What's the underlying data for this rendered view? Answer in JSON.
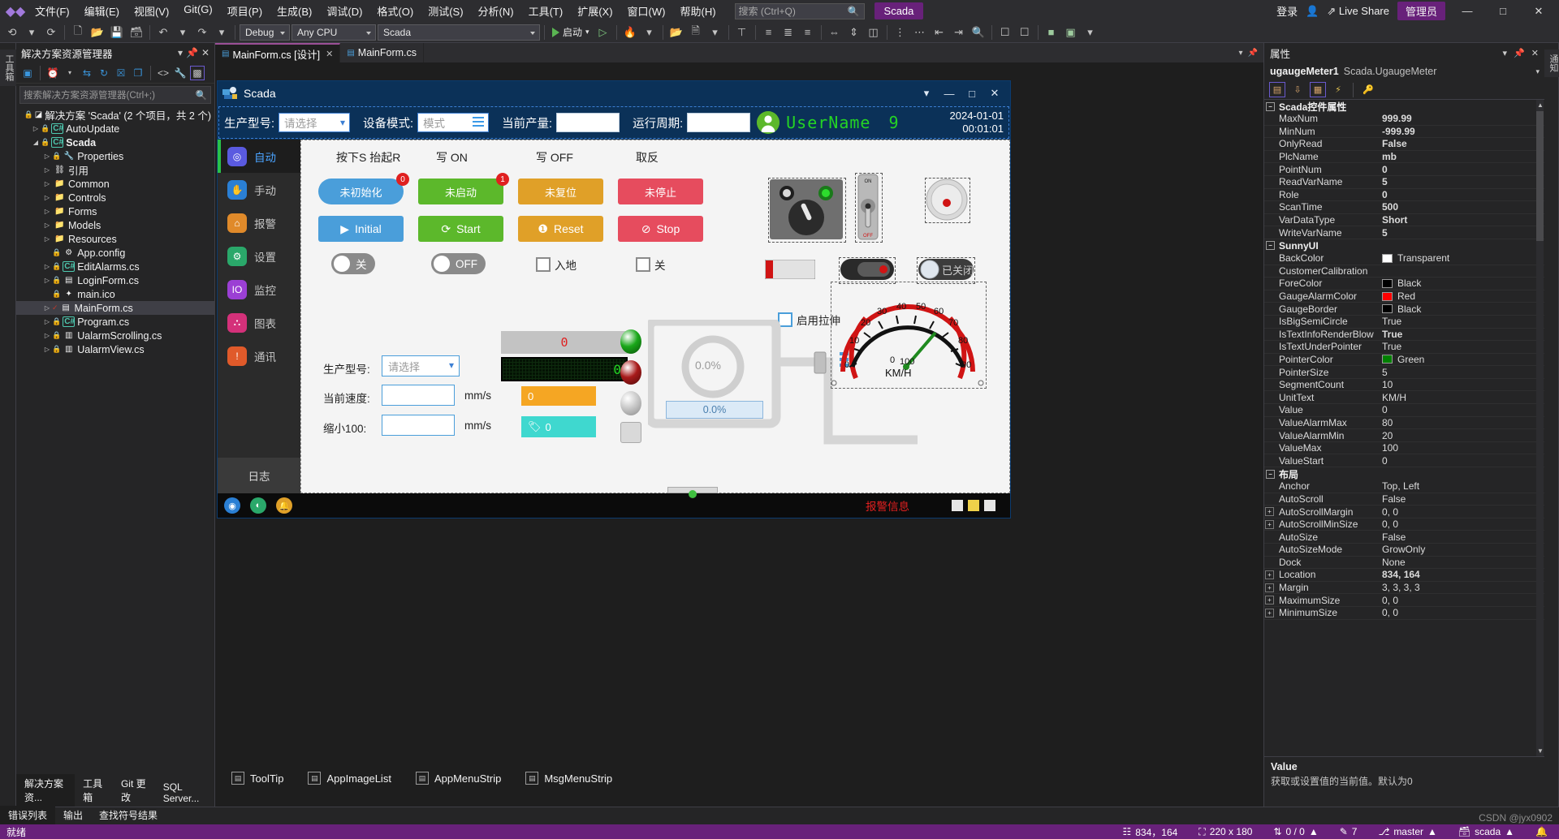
{
  "ide": {
    "menus": [
      "文件(F)",
      "编辑(E)",
      "视图(V)",
      "Git(G)",
      "项目(P)",
      "生成(B)",
      "调试(D)",
      "格式(O)",
      "测试(S)",
      "分析(N)",
      "工具(T)",
      "扩展(X)",
      "窗口(W)",
      "帮助(H)"
    ],
    "search_placeholder": "搜索 (Ctrl+Q)",
    "project_chip": "Scada",
    "login_label": "登录",
    "live_share": "Live Share",
    "admin_badge": "管理员",
    "toolbar": {
      "config": "Debug",
      "platform": "Any CPU",
      "startup_project": "Scada",
      "run_label": "启动"
    }
  },
  "solution_explorer": {
    "title": "解决方案资源管理器",
    "search_placeholder": "搜索解决方案资源管理器(Ctrl+;)",
    "rail_tab": "工具箱",
    "tree": [
      {
        "label": "解决方案 'Scada' (2 个项目，共 2 个)",
        "indent": 0,
        "arrow": "",
        "icon": "solution-icon",
        "lock": true,
        "bold": false
      },
      {
        "label": "AutoUpdate",
        "indent": 1,
        "arrow": "▷",
        "icon": "csharp-icon",
        "lock": true,
        "bold": false
      },
      {
        "label": "Scada",
        "indent": 1,
        "arrow": "◢",
        "icon": "csharp-icon",
        "lock": true,
        "bold": true
      },
      {
        "label": "Properties",
        "indent": 2,
        "arrow": "▷",
        "icon": "wrench-icon",
        "lock": true,
        "bold": false
      },
      {
        "label": "引用",
        "indent": 2,
        "arrow": "▷",
        "icon": "references-icon",
        "lock": false,
        "bold": false
      },
      {
        "label": "Common",
        "indent": 2,
        "arrow": "▷",
        "icon": "folder-icon",
        "lock": false,
        "bold": false
      },
      {
        "label": "Controls",
        "indent": 2,
        "arrow": "▷",
        "icon": "folder-icon",
        "lock": false,
        "bold": false
      },
      {
        "label": "Forms",
        "indent": 2,
        "arrow": "▷",
        "icon": "folder-icon",
        "lock": false,
        "bold": false
      },
      {
        "label": "Models",
        "indent": 2,
        "arrow": "▷",
        "icon": "folder-icon",
        "lock": false,
        "bold": false
      },
      {
        "label": "Resources",
        "indent": 2,
        "arrow": "▷",
        "icon": "folder-icon",
        "lock": false,
        "bold": false
      },
      {
        "label": "App.config",
        "indent": 2,
        "arrow": "",
        "icon": "config-icon",
        "lock": true,
        "bold": false
      },
      {
        "label": "EditAlarms.cs",
        "indent": 2,
        "arrow": "▷",
        "icon": "csharp-icon",
        "lock": true,
        "bold": false
      },
      {
        "label": "LoginForm.cs",
        "indent": 2,
        "arrow": "▷",
        "icon": "form-icon",
        "lock": true,
        "bold": false
      },
      {
        "label": "main.ico",
        "indent": 2,
        "arrow": "",
        "icon": "image-icon",
        "lock": true,
        "bold": false
      },
      {
        "label": "MainForm.cs",
        "indent": 2,
        "arrow": "▷",
        "icon": "form-icon",
        "lock": false,
        "bold": false,
        "selected": true,
        "check": true
      },
      {
        "label": "Program.cs",
        "indent": 2,
        "arrow": "▷",
        "icon": "csharp-icon",
        "lock": true,
        "bold": false
      },
      {
        "label": "UalarmScrolling.cs",
        "indent": 2,
        "arrow": "▷",
        "icon": "usercontrol-icon",
        "lock": true,
        "bold": false
      },
      {
        "label": "UalarmView.cs",
        "indent": 2,
        "arrow": "▷",
        "icon": "usercontrol-icon",
        "lock": true,
        "bold": false
      }
    ],
    "bottom_tabs": [
      "解决方案资...",
      "工具箱",
      "Git 更改",
      "SQL Server..."
    ]
  },
  "editor_tabs": [
    {
      "label": "MainForm.cs [设计]",
      "active": true,
      "closable": true
    },
    {
      "label": "MainForm.cs",
      "active": false,
      "closable": false
    }
  ],
  "scada": {
    "title": "Scada",
    "header": {
      "model_label": "生产型号:",
      "model_value": "请选择",
      "mode_label": "设备模式:",
      "mode_value": "模式",
      "output_label": "当前产量:",
      "output_value": "",
      "cycle_label": "运行周期:",
      "cycle_value": "",
      "user_name": "UserName",
      "user_num": "9",
      "date": "2024-01-01",
      "time": "00:01:01"
    },
    "nav": [
      {
        "label": "自动",
        "icon": "auto-icon",
        "color": "#5a5ae0",
        "active": true
      },
      {
        "label": "手动",
        "icon": "hand-icon",
        "color": "#2a7fd4",
        "active": false
      },
      {
        "label": "报警",
        "icon": "alarm-icon",
        "color": "#e08a2a",
        "active": false
      },
      {
        "label": "设置",
        "icon": "gear-icon",
        "color": "#2aa86a",
        "active": false
      },
      {
        "label": "监控",
        "icon": "monitor-icon",
        "color": "#9b3fd4",
        "active": false
      },
      {
        "label": "图表",
        "icon": "chart-icon",
        "color": "#d4317a",
        "active": false
      },
      {
        "label": "通讯",
        "icon": "comm-icon",
        "color": "#e05a2a",
        "active": false
      }
    ],
    "log_tab": "日志",
    "columns": [
      {
        "title": "按下S 抬起R",
        "pill": "未初始化",
        "badge": "0",
        "btn": "Initial",
        "btn_icon": "play-icon",
        "color": "#4a9eda",
        "toggle": "关"
      },
      {
        "title": "写 ON",
        "pill": "未启动",
        "badge": "1",
        "btn": "Start",
        "btn_icon": "refresh-icon",
        "color": "#5cb82b",
        "toggle": "OFF"
      },
      {
        "title": "写 OFF",
        "pill": "未复位",
        "badge": "",
        "btn": "Reset",
        "btn_icon": "warn-icon",
        "color": "#e0a028",
        "toggle": "入地"
      },
      {
        "title": "取反",
        "pill": "未停止",
        "badge": "",
        "btn": "Stop",
        "btn_icon": "stop-icon",
        "color": "#e64c5e",
        "toggle": "关"
      }
    ],
    "stretch_checkbox": "启用拉伸",
    "closed_switch": "已关闭",
    "display_value": "0",
    "dot_value": "0",
    "form": {
      "model_label": "生产型号:",
      "model_value": "请选择",
      "speed_label": "当前速度:",
      "speed_value": "",
      "speed_unit": "mm/s",
      "scale_label": "缩小100:",
      "scale_value": "",
      "scale_unit": "mm/s"
    },
    "orange_value": "0",
    "teal_value": "0",
    "tank_value": "0.0%",
    "tank_bar_value": "0.0%",
    "gauge": {
      "ticks": [
        "0",
        "10",
        "20",
        "30",
        "40",
        "50",
        "60",
        "70",
        "80",
        "90",
        "100"
      ],
      "unit": "KM/H",
      "center_value": "0"
    },
    "alarm_text": "报警信息"
  },
  "tray": [
    {
      "label": "ToolTip",
      "icon": "tooltip-icon"
    },
    {
      "label": "AppImageList",
      "icon": "imagelist-icon"
    },
    {
      "label": "AppMenuStrip",
      "icon": "menustrip-icon"
    },
    {
      "label": "MsgMenuStrip",
      "icon": "menustrip-icon"
    }
  ],
  "properties": {
    "title": "属性",
    "object_name": "ugaugeMeter1",
    "object_type": "Scada.UgaugeMeter",
    "groups": [
      {
        "name": "Scada控件属性",
        "rows": [
          {
            "name": "MaxNum",
            "value": "999.99",
            "bold": true
          },
          {
            "name": "MinNum",
            "value": "-999.99",
            "bold": true
          },
          {
            "name": "OnlyRead",
            "value": "False",
            "bold": true
          },
          {
            "name": "PlcName",
            "value": "mb",
            "bold": true
          },
          {
            "name": "PointNum",
            "value": "0",
            "bold": true
          },
          {
            "name": "ReadVarName",
            "value": "5",
            "bold": true
          },
          {
            "name": "Role",
            "value": "0",
            "bold": true
          },
          {
            "name": "ScanTime",
            "value": "500",
            "bold": true
          },
          {
            "name": "VarDataType",
            "value": "Short",
            "bold": true
          },
          {
            "name": "WriteVarName",
            "value": "5",
            "bold": true
          }
        ]
      },
      {
        "name": "SunnyUI",
        "rows": [
          {
            "name": "BackColor",
            "value": "Transparent",
            "swatch": "#ffffff"
          },
          {
            "name": "CustomerCalibration",
            "value": ""
          },
          {
            "name": "ForeColor",
            "value": "Black",
            "swatch": "#000000"
          },
          {
            "name": "GaugeAlarmColor",
            "value": "Red",
            "swatch": "#ff0000"
          },
          {
            "name": "GaugeBorder",
            "value": "Black",
            "swatch": "#000000"
          },
          {
            "name": "IsBigSemiCircle",
            "value": "True"
          },
          {
            "name": "IsTextInfoRenderBlow",
            "value": "True",
            "bold": true
          },
          {
            "name": "IsTextUnderPointer",
            "value": "True"
          },
          {
            "name": "PointerColor",
            "value": "Green",
            "swatch": "#008000"
          },
          {
            "name": "PointerSize",
            "value": "5"
          },
          {
            "name": "SegmentCount",
            "value": "10"
          },
          {
            "name": "UnitText",
            "value": "KM/H"
          },
          {
            "name": "Value",
            "value": "0"
          },
          {
            "name": "ValueAlarmMax",
            "value": "80"
          },
          {
            "name": "ValueAlarmMin",
            "value": "20"
          },
          {
            "name": "ValueMax",
            "value": "100"
          },
          {
            "name": "ValueStart",
            "value": "0"
          }
        ]
      },
      {
        "name": "布局",
        "rows": [
          {
            "name": "Anchor",
            "value": "Top, Left"
          },
          {
            "name": "AutoScroll",
            "value": "False"
          },
          {
            "name": "AutoScrollMargin",
            "value": "0, 0",
            "exp": true
          },
          {
            "name": "AutoScrollMinSize",
            "value": "0, 0",
            "exp": true
          },
          {
            "name": "AutoSize",
            "value": "False"
          },
          {
            "name": "AutoSizeMode",
            "value": "GrowOnly"
          },
          {
            "name": "Dock",
            "value": "None"
          },
          {
            "name": "Location",
            "value": "834, 164",
            "exp": true,
            "bold": true
          },
          {
            "name": "Margin",
            "value": "3, 3, 3, 3",
            "exp": true
          },
          {
            "name": "MaximumSize",
            "value": "0, 0",
            "exp": true
          },
          {
            "name": "MinimumSize",
            "value": "0, 0",
            "exp": true
          }
        ]
      }
    ],
    "desc_title": "Value",
    "desc_body": "获取或设置值的当前值。默认为0",
    "rail_tab": "通知"
  },
  "dock_tabs": [
    "错误列表",
    "输出",
    "查找符号结果"
  ],
  "statusbar": {
    "state": "就绪",
    "location": "834，164",
    "size": "220 x 180",
    "changes": "0 / 0",
    "pending": "7",
    "branch": "master",
    "repo": "scada",
    "watermark": "CSDN @jyx0902"
  }
}
